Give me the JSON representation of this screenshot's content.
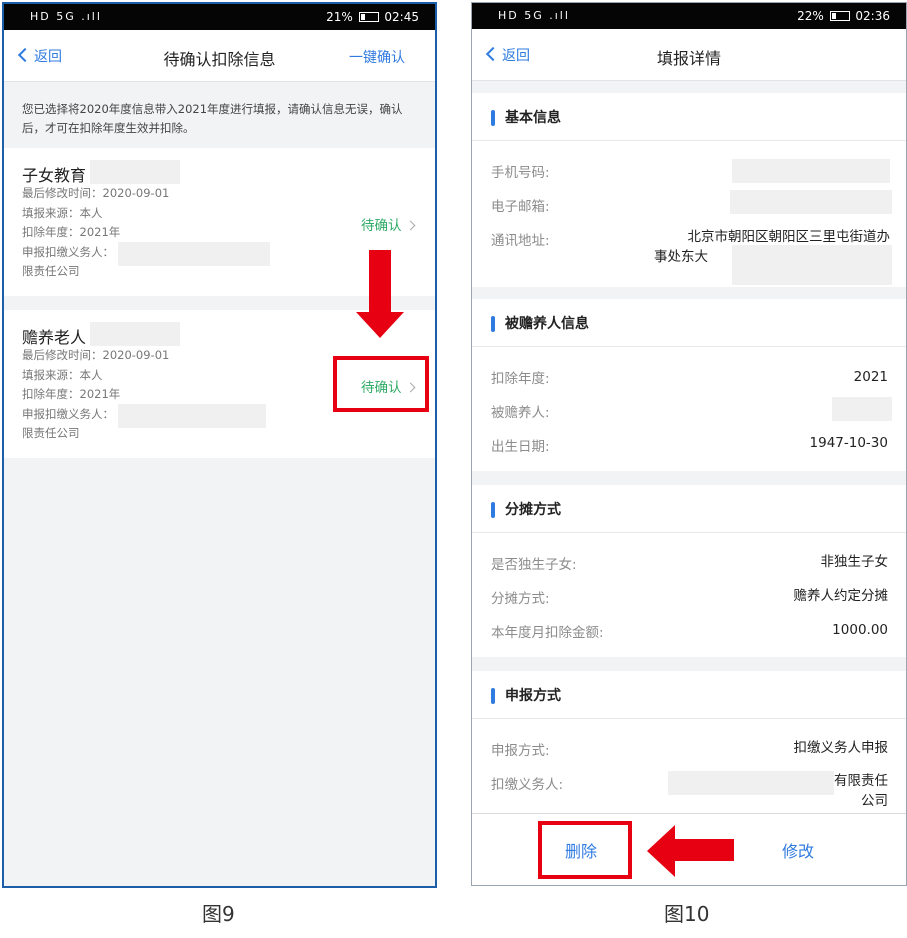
{
  "left": {
    "status": {
      "left": "HD 5G .ıll",
      "right": "21% ",
      "time": "02:45"
    },
    "nav": {
      "back": "返回",
      "title": "待确认扣除信息",
      "action": "一键确认"
    },
    "notice": "您已选择将2020年度信息带入2021年度进行填报，请确认信息无误，确认后，才可在扣除年度生效并扣除。",
    "cards": [
      {
        "title": "子女教育",
        "modified": "最后修改时间：2020-09-01",
        "source": "填报来源：本人",
        "year": "扣除年度：2021年",
        "agent": "申报扣缴义务人：",
        "company": "限责任公司",
        "status": "待确认"
      },
      {
        "title": "赡养老人",
        "modified": "最后修改时间：2020-09-01",
        "source": "填报来源：本人",
        "year": "扣除年度：2021年",
        "agent": "申报扣缴义务人：",
        "company": "限责任公司",
        "status": "待确认"
      }
    ],
    "caption": "图9"
  },
  "right": {
    "status": {
      "left": "HD 5G .ıll",
      "right": "22% ",
      "time": "02:36"
    },
    "nav": {
      "back": "返回",
      "title": "填报详情"
    },
    "sections": {
      "basic": {
        "title": "基本信息",
        "phone_label": "手机号码:",
        "email_label": "电子邮箱:",
        "address_label": "通讯地址:",
        "address_line1": "北京市朝阳区朝阳区三里屯街道办",
        "address_line2": "事处东大"
      },
      "dependent": {
        "title": "被赡养人信息",
        "year_label": "扣除年度:",
        "year_value": "2021",
        "person_label": "被赡养人:",
        "birth_label": "出生日期:",
        "birth_value": "1947-10-30"
      },
      "split": {
        "title": "分摊方式",
        "only_child_label": "是否独生子女:",
        "only_child_value": "非独生子女",
        "method_label": "分摊方式:",
        "method_value": "赡养人约定分摊",
        "amount_label": "本年度月扣除金额:",
        "amount_value": "1000.00"
      },
      "declare": {
        "title": "申报方式",
        "method_label": "申报方式:",
        "method_value": "扣缴义务人申报",
        "agent_label": "扣缴义务人:",
        "agent_value_line1": "有限责任",
        "agent_value_line2": "公司"
      }
    },
    "buttons": {
      "delete": "删除",
      "edit": "修改"
    },
    "caption": "图10"
  },
  "colors": {
    "accent": "#2f7be0",
    "pending": "#2eab65",
    "highlight": "#e60012"
  }
}
